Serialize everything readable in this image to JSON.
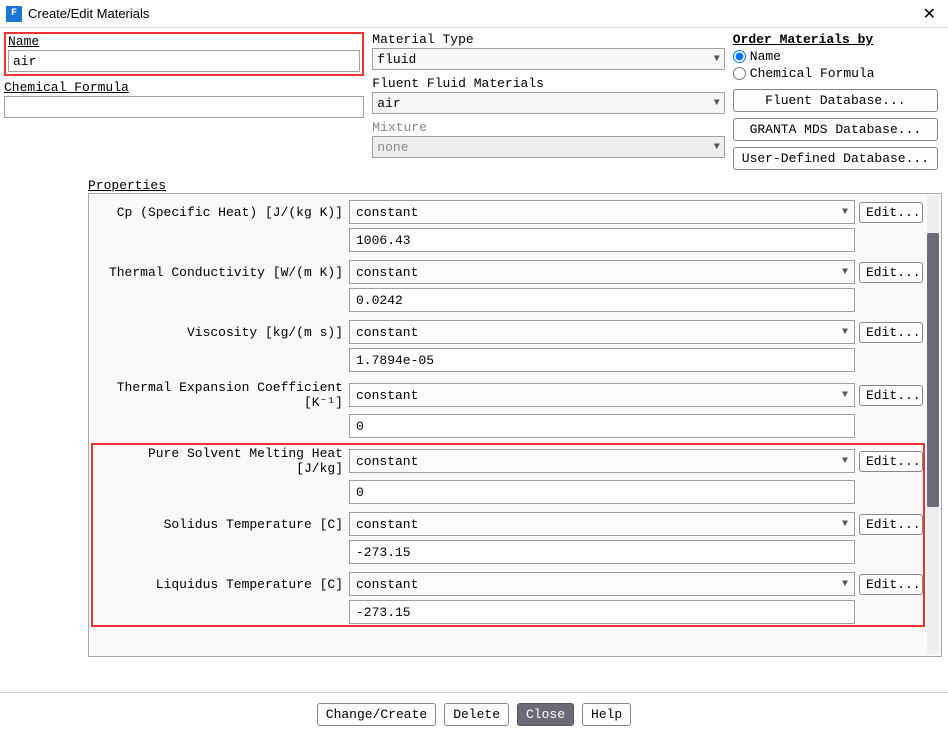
{
  "window": {
    "title": "Create/Edit Materials",
    "icon_letter": "F"
  },
  "left": {
    "name_label": "Name",
    "name_value": "air",
    "formula_label": "Chemical Formula",
    "formula_value": ""
  },
  "mid": {
    "type_label": "Material Type",
    "type_value": "fluid",
    "fluid_label": "Fluent Fluid Materials",
    "fluid_value": "air",
    "mixture_label": "Mixture",
    "mixture_value": "none"
  },
  "right": {
    "order_label": "Order Materials by",
    "radio_name": "Name",
    "radio_formula": "Chemical Formula",
    "btn_fluent": "Fluent Database...",
    "btn_granta": "GRANTA MDS Database...",
    "btn_user": "User-Defined Database..."
  },
  "props_title": "Properties",
  "edit_label": "Edit...",
  "props": [
    {
      "label": "Cp (Specific Heat) [J/(kg K)]",
      "method": "constant",
      "value": "1006.43"
    },
    {
      "label": "Thermal Conductivity [W/(m K)]",
      "method": "constant",
      "value": "0.0242"
    },
    {
      "label": "Viscosity [kg/(m s)]",
      "method": "constant",
      "value": "1.7894e-05"
    },
    {
      "label": "Thermal Expansion Coefficient [K⁻¹]",
      "method": "constant",
      "value": "0"
    },
    {
      "label": "Pure Solvent Melting Heat [J/kg]",
      "method": "constant",
      "value": "0"
    },
    {
      "label": "Solidus Temperature [C]",
      "method": "constant",
      "value": "-273.15"
    },
    {
      "label": "Liquidus Temperature [C]",
      "method": "constant",
      "value": "-273.15"
    }
  ],
  "buttons": {
    "change": "Change/Create",
    "delete": "Delete",
    "close": "Close",
    "help": "Help"
  }
}
